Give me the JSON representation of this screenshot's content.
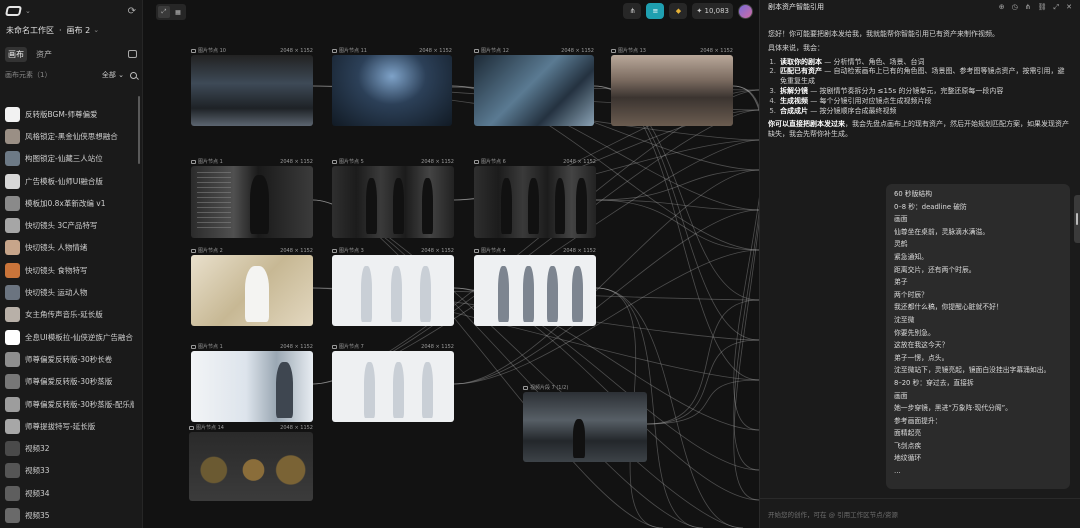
{
  "sidebar": {
    "workspace": "未命名工作区",
    "canvas_name": "画布 2",
    "tabs": [
      {
        "label": "画布",
        "active": true
      },
      {
        "label": "资产",
        "active": false
      }
    ],
    "filter_label": "画布元素（1）",
    "filter_value": "全部",
    "items": [
      {
        "label": "反转版BGM-师尊偏爱",
        "thumb": "#f2f2f2"
      },
      {
        "label": "风格锁定-黑金仙侠思想融合",
        "thumb": "#9a8f85"
      },
      {
        "label": "构图锁定-仙藏三人站位",
        "thumb": "#6d7a86"
      },
      {
        "label": "广告模板-仙师UI融合版",
        "thumb": "#d7d7d7"
      },
      {
        "label": "模板加0.8x革新改编 v1",
        "thumb": "#8a8a8a"
      },
      {
        "label": "快切镜头 3C产品特写",
        "thumb": "#a6a6a6"
      },
      {
        "label": "快切镜头 人物情绪",
        "thumb": "#c7a58a"
      },
      {
        "label": "快切镜头 食物特写",
        "thumb": "#c9743a"
      },
      {
        "label": "快切镜头 运动人物",
        "thumb": "#6b7480"
      },
      {
        "label": "女主角传声音乐-延长版",
        "thumb": "#b8b0a8"
      },
      {
        "label": "全息UI模板拉-仙侠逆族广告融合",
        "thumb": "#ffffff"
      },
      {
        "label": "师尊偏爱反转版-30秒长卷",
        "thumb": "#8e8e8e"
      },
      {
        "label": "师尊偏爱反转版-30秒蒸版",
        "thumb": "#777777"
      },
      {
        "label": "师尊偏爱反转版-30秒蒸版-配乐版",
        "thumb": "#9d9d9d"
      },
      {
        "label": "师尊提拔特写-延长版",
        "thumb": "#a7a7a7"
      },
      {
        "label": "视频32",
        "thumb": "#4a4a4a"
      },
      {
        "label": "视频33",
        "thumb": "#555555"
      },
      {
        "label": "视频34",
        "thumb": "#5e5e5e"
      },
      {
        "label": "视频35",
        "thumb": "#6a6a6a"
      }
    ]
  },
  "canvas": {
    "credits": "10,083",
    "nodes": [
      {
        "title": "图片节点 10",
        "dims": "2048 × 1152"
      },
      {
        "title": "图片节点 11",
        "dims": "2048 × 1152"
      },
      {
        "title": "图片节点 12",
        "dims": "2048 × 1152"
      },
      {
        "title": "图片节点 13",
        "dims": "2048 × 1152"
      },
      {
        "title": "图片节点 1",
        "dims": "2048 × 1152"
      },
      {
        "title": "图片节点 5",
        "dims": "2048 × 1152"
      },
      {
        "title": "图片节点 6",
        "dims": "2048 × 1152"
      },
      {
        "title": "图片节点 2",
        "dims": "2048 × 1152"
      },
      {
        "title": "图片节点 3",
        "dims": "2048 × 1152"
      },
      {
        "title": "图片节点 4",
        "dims": "2048 × 1152"
      },
      {
        "title": "图片节点 1",
        "dims": "2048 × 1152"
      },
      {
        "title": "图片节点 7",
        "dims": "2048 × 1152"
      },
      {
        "title": "图片节点 14",
        "dims": "2048 × 1152"
      },
      {
        "title": "视频片段 7 (1/2)",
        "dims": ""
      }
    ]
  },
  "chat": {
    "title": "剧本资产智能引用",
    "intro": "您好！你可能要把剧本发给我，我就能帮你智能引用已有资产来制作视频。",
    "flow_label": "具体来说，我会：",
    "steps": [
      {
        "num": "1.",
        "bold": "读取你的剧本",
        "text": " — 分析情节、角色、场景、台词"
      },
      {
        "num": "2.",
        "bold": "匹配已有资产",
        "text": " — 自动检索画布上已有的角色图、场景图、参考图等镜点资产，按需引用，避免重复生成"
      },
      {
        "num": "3.",
        "bold": "拆解分镜",
        "text": " — 按剧情节奏拆分为 ≤15s 的分镜单元，完整还原每一段内容"
      },
      {
        "num": "4.",
        "bold": "生成视频",
        "text": " — 每个分镜引用对应镜点生成视频片段"
      },
      {
        "num": "5.",
        "bold": "合成成片",
        "text": " — 按分镜顺序合成最终视频"
      }
    ],
    "cta": "你可以直接把剧本发过来，我会先盘点画布上的现有资产，然后开始规划匹配方案，如果发现资产缺失，我会先帮你补生成。",
    "user_message": [
      "60 秒版结构",
      "0–8 秒：deadline 破防",
      "画面",
      "仙尊坐在桌前，灵脉滴水满溢。",
      "灵鹤",
      "紧急通知。",
      "距离交片，还有两个时辰。",
      "弟子",
      "两个时辰？",
      "我还都什么稿，你提醒心脏就不好！",
      "沈至微",
      "你要先别急。",
      "这放在我这今天？",
      "弟子一愣，点头。",
      "沈至微站下，灵镜亮起，镜面白没挂出字幕涌如出。",
      "8–20 秒：穿过去，直接拆",
      "画面",
      "她一步穿镜，黑进“万象阵·现代分阁”。",
      "参考画面提升：",
      "面精起亮",
      "飞剑点疾",
      "地纹循环",
      "…"
    ],
    "input_placeholder": "开始您的创作，可在 @ 引用工作区节点/资源"
  }
}
